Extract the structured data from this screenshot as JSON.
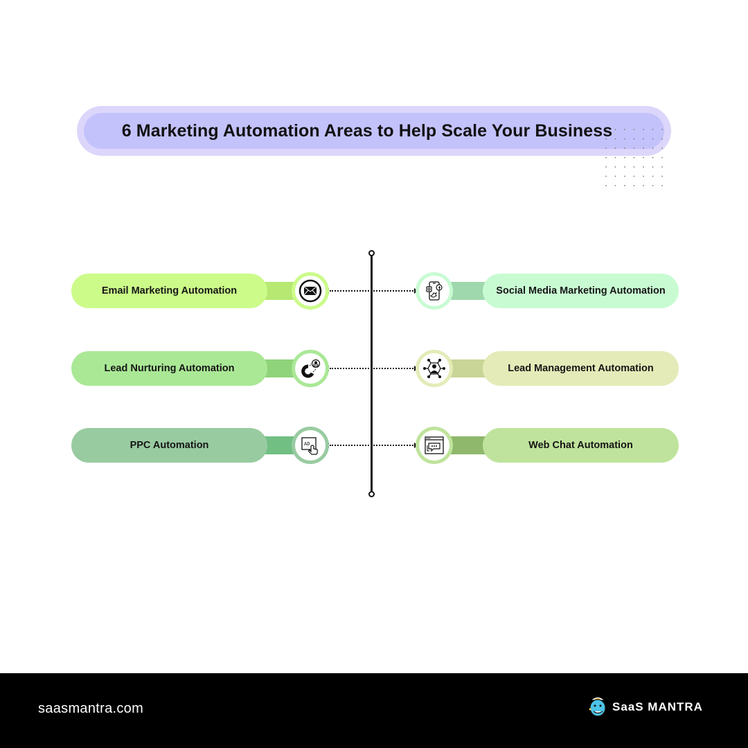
{
  "title": "6 Marketing Automation Areas to Help Scale Your Business",
  "colors": {
    "title_outer": "#dcd6fb",
    "title_inner": "#c4c2fb",
    "footer_bg": "#000000"
  },
  "items": [
    {
      "side": "left",
      "label": "Email Marketing Automation",
      "icon": "email-envelope-icon",
      "pill": "#ccfb8a",
      "neck": "#b6e872",
      "ring": "#ccfb8a"
    },
    {
      "side": "right",
      "label": "Social Media Marketing Automation",
      "icon": "social-media-phone-icon",
      "pill": "#c9fbd3",
      "neck": "#9fd8ac",
      "ring": "#c9fbd3"
    },
    {
      "side": "left",
      "label": "Lead Nurturing Automation",
      "icon": "magnet-user-icon",
      "pill": "#aae896",
      "neck": "#8fd47a",
      "ring": "#aae896"
    },
    {
      "side": "right",
      "label": "Lead Management Automation",
      "icon": "network-user-icon",
      "pill": "#e4ebb8",
      "neck": "#c8d596",
      "ring": "#e4ebb8"
    },
    {
      "side": "left",
      "label": "PPC Automation",
      "icon": "ad-click-icon",
      "pill": "#99cba1",
      "neck": "#72bf84",
      "ring": "#99cba1"
    },
    {
      "side": "right",
      "label": "Web Chat Automation",
      "icon": "web-chat-window-icon",
      "pill": "#bfe39c",
      "neck": "#8fb86c",
      "ring": "#bfe39c"
    }
  ],
  "footer": {
    "url": "saasmantra.com",
    "brand_name": "SaaS MANTRA",
    "brand_logo_icon": "mascot-head-icon"
  }
}
